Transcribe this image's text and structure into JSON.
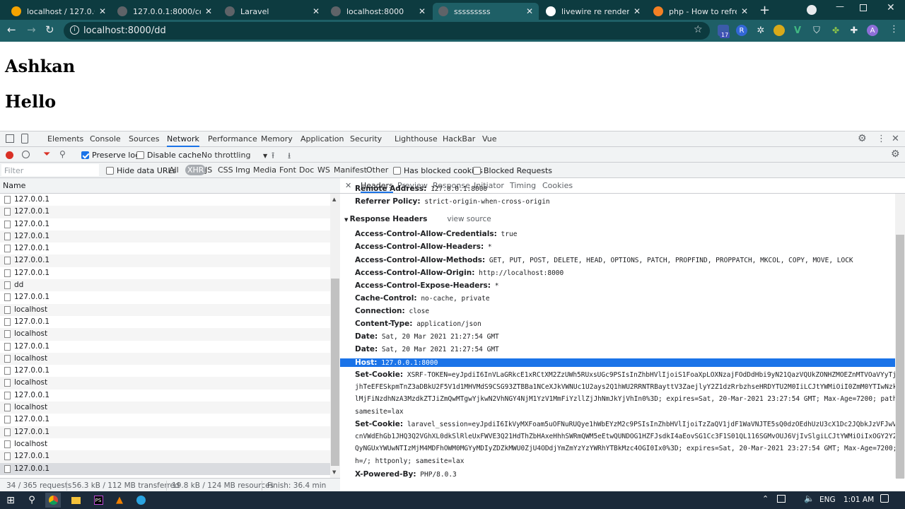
{
  "browser": {
    "tabs": [
      {
        "title": "localhost / 127.0.0.1 / ...",
        "favicon": "phpmyadmin-icon",
        "color": "#f4a300"
      },
      {
        "title": "127.0.0.1:8000/comm...",
        "favicon": "globe-icon",
        "color": "#5f6368"
      },
      {
        "title": "Laravel",
        "favicon": "globe-icon",
        "color": "#5f6368"
      },
      {
        "title": "localhost:8000",
        "favicon": "globe-icon",
        "color": "#5f6368"
      },
      {
        "title": "sssssssss",
        "favicon": "globe-icon",
        "color": "#5f6368"
      },
      {
        "title": "livewire re render com...",
        "favicon": "google-icon",
        "color": "#ffffff"
      },
      {
        "title": "php - How to refresh ...",
        "favicon": "stackoverflow-icon",
        "color": "#f48024"
      }
    ],
    "url": "localhost:8000/dd",
    "extension_badge": "17",
    "profile_initial": "A"
  },
  "page": {
    "heading1": "Ashkan",
    "heading2": "Hello"
  },
  "devtools": {
    "tabs": [
      "Elements",
      "Console",
      "Sources",
      "Network",
      "Performance",
      "Memory",
      "Application",
      "Security",
      "Lighthouse",
      "HackBar",
      "Vue"
    ],
    "active_tab": "Network",
    "toolbar": {
      "preserve_log": "Preserve log",
      "disable_cache": "Disable cache",
      "throttling": "No throttling"
    },
    "filter": {
      "placeholder": "Filter",
      "hide_data_urls": "Hide data URLs",
      "types": [
        "All",
        "XHR",
        "JS",
        "CSS",
        "Img",
        "Media",
        "Font",
        "Doc",
        "WS",
        "Manifest",
        "Other"
      ],
      "active_type": "XHR",
      "has_blocked_cookies": "Has blocked cookies",
      "blocked_requests": "Blocked Requests"
    },
    "name_header": "Name",
    "requests": [
      "127.0.0.1",
      "127.0.0.1",
      "127.0.0.1",
      "127.0.0.1",
      "127.0.0.1",
      "127.0.0.1",
      "127.0.0.1",
      "dd",
      "127.0.0.1",
      "localhost",
      "127.0.0.1",
      "localhost",
      "127.0.0.1",
      "localhost",
      "127.0.0.1",
      "localhost",
      "127.0.0.1",
      "localhost",
      "127.0.0.1",
      "127.0.0.1",
      "localhost",
      "127.0.0.1",
      "127.0.0.1"
    ],
    "detail_tabs": [
      "Headers",
      "Preview",
      "Response",
      "Initiator",
      "Timing",
      "Cookies"
    ],
    "general": [
      {
        "k": "Remote Address:",
        "v": "127.0.0.1:8000"
      },
      {
        "k": "Referrer Policy:",
        "v": "strict-origin-when-cross-origin"
      }
    ],
    "response_headers_title": "Response Headers",
    "view_source": "view source",
    "response_headers": [
      {
        "k": "Access-Control-Allow-Credentials:",
        "v": "true"
      },
      {
        "k": "Access-Control-Allow-Headers:",
        "v": "*"
      },
      {
        "k": "Access-Control-Allow-Methods:",
        "v": "GET, PUT, POST, DELETE, HEAD, OPTIONS, PATCH, PROPFIND, PROPPATCH, MKCOL, COPY, MOVE, LOCK"
      },
      {
        "k": "Access-Control-Allow-Origin:",
        "v": "http://localhost:8000"
      },
      {
        "k": "Access-Control-Expose-Headers:",
        "v": "*"
      },
      {
        "k": "Cache-Control:",
        "v": "no-cache, private"
      },
      {
        "k": "Connection:",
        "v": "close"
      },
      {
        "k": "Content-Type:",
        "v": "application/json"
      },
      {
        "k": "Date:",
        "v": "Sat, 20 Mar 2021 21:27:54 GMT"
      },
      {
        "k": "Date:",
        "v": "Sat, 20 Mar 2021 21:27:54 GMT"
      },
      {
        "k": "Host:",
        "v": "127.0.0.1:8000"
      }
    ],
    "set_cookie_1": {
      "k": "Set-Cookie:",
      "v": "XSRF-TOKEN=eyJpdiI6InVLaGRkcE1xRCtXM2ZzUWh5RUxsUGc9PSIsInZhbHVlIjoiS1FoaXpLOXNzajFOdDdHbi9yN21QazVQUkZONHZMOEZnMTVOaVYyTjh6K1hXb",
      "cont": [
        "jhTeEFESkpmTnZ3aDBkU2F5V1d1MHVMdS9CSG93ZTBBa1NCeXJkVWNUc1U2ays2Q1hWU2RRNTRBayttV3ZaejlyY2Z1dzRrbzhseHRDYTU2M0IiLCJtYWMiOiI0ZmM0YTIwNzkzMjl",
        "lMjFiNzdhNzA3MzdkZTJiZmQwMTgwYjkwN2VhNGY4NjM1YzV1MmFiYzllZjJhNmJkYjVhIn0%3D; expires=Sat, 20-Mar-2021 23:27:54 GMT; Max-Age=7200; path=/;",
        "samesite=lax"
      ]
    },
    "set_cookie_2": {
      "k": "Set-Cookie:",
      "v": "laravel_session=eyJpdiI6IkVyMXFoam5uOFNuRUQye1hWbEYzM2c9PSIsInZhbHVlIjoiTzZaQV1jdF1WaVNJTE5sQ0dzOEdhUzU3cX1Dc2JQbkJzVFJwV2ZjK1Nm",
      "cont": [
        "cnVWdEhGb1JHQ3Q2VGhXL0dkSlRleUxFWVE3Q21HdThZbHAxeHhhSWRmQWM5eEtwQUNDOG1HZFJsdkI4aEovSG1Cc3F1S01QL116SGMvOUJ6VjIvSlgiLCJtYWMiOiIxOGY2Y2E2NT",
        "QyNGUxYWUwNTIzMjM4MDFhOWM0MGYyMDIyZDZkMWU0ZjU4ODdjYmZmYzYzYWRhYTBkMzc4OGI0Ix0%3D; expires=Sat, 20-Mar-2021 23:27:54 GMT; Max-Age=7200; pat",
        "h=/; httponly; samesite=lax"
      ]
    },
    "powered_by": {
      "k": "X-Powered-By:",
      "v": "PHP/8.0.3"
    },
    "status": {
      "requests": "34 / 365 requests",
      "transferred": "56.3 kB / 112 MB transferred",
      "resources": "19.8 kB / 124 MB resources",
      "finish": "Finish: 36.4 min"
    }
  },
  "taskbar": {
    "language": "ENG",
    "time": "1:01 AM"
  }
}
